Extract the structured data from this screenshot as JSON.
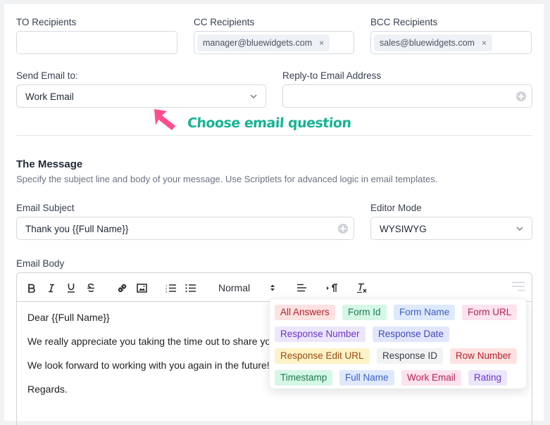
{
  "recipients": {
    "to": {
      "label": "TO Recipients",
      "chips": []
    },
    "cc": {
      "label": "CC Recipients",
      "chips": [
        "manager@bluewidgets.com"
      ]
    },
    "bcc": {
      "label": "BCC Recipients",
      "chips": [
        "sales@bluewidgets.com"
      ]
    },
    "remove_glyph": "×"
  },
  "send_to": {
    "label": "Send Email to:",
    "value": "Work Email"
  },
  "reply_to": {
    "label": "Reply-to Email Address",
    "value": ""
  },
  "annotation": {
    "text": "Choose email question",
    "color": "#18b394",
    "arrow_color": "#ff4d8d"
  },
  "message": {
    "title": "The Message",
    "description": "Specify the subject line and body of your message. Use Scriptlets for advanced logic in email templates."
  },
  "subject": {
    "label": "Email Subject",
    "value": "Thank you {{Full Name}}"
  },
  "editor_mode": {
    "label": "Editor Mode",
    "value": "WYSIWYG"
  },
  "body": {
    "label": "Email Body",
    "toolbar": {
      "heading_select": "Normal",
      "buttons": [
        "bold",
        "italic",
        "underline",
        "strikethrough",
        "link",
        "image",
        "ordered-list",
        "bullet-list",
        "heading",
        "align",
        "text-direction",
        "clear-format"
      ]
    },
    "lines": [
      "Dear  {{Full Name}}",
      "We really appreciate you taking the time out to share yo",
      "We look forward to working with you again in the future!",
      "Regards."
    ]
  },
  "variables": {
    "rows": [
      [
        {
          "label": "All Answers",
          "bg": "#fde2e2",
          "fg": "#b4232d"
        },
        {
          "label": "Form Id",
          "bg": "#d5f7e6",
          "fg": "#1f7a52"
        },
        {
          "label": "Form Name",
          "bg": "#dfe9fd",
          "fg": "#3a5fc4"
        },
        {
          "label": "Form URL",
          "bg": "#fde3ee",
          "fg": "#b42358"
        }
      ],
      [
        {
          "label": "Response Number",
          "bg": "#ece6fd",
          "fg": "#6b35c9"
        },
        {
          "label": "Response Date",
          "bg": "#e2e6fc",
          "fg": "#4148b8"
        }
      ],
      [
        {
          "label": "Response Edit URL",
          "bg": "#fdf3c8",
          "fg": "#9a4a12"
        },
        {
          "label": "Response ID",
          "bg": "#f1f2f4",
          "fg": "#3a3f47"
        },
        {
          "label": "Row Number",
          "bg": "#fde2e2",
          "fg": "#b4232d"
        }
      ],
      [
        {
          "label": "Timestamp",
          "bg": "#d5f7e6",
          "fg": "#1f7a52"
        },
        {
          "label": "Full Name",
          "bg": "#dfe9fd",
          "fg": "#3a5fc4"
        },
        {
          "label": "Work Email",
          "bg": "#fde3ee",
          "fg": "#b42358"
        },
        {
          "label": "Rating",
          "bg": "#ece6fd",
          "fg": "#6b35c9"
        }
      ]
    ]
  }
}
